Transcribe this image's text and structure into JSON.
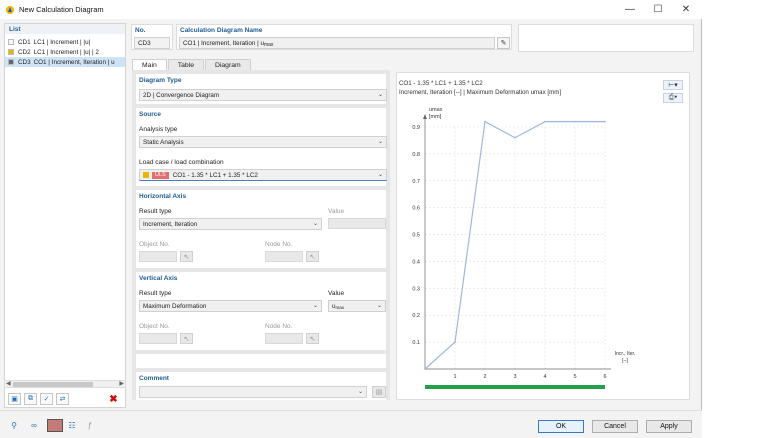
{
  "window": {
    "title": "New Calculation Diagram"
  },
  "list": {
    "header": "List",
    "items": [
      {
        "code": "CD1",
        "label": "LC1 | Increment | |u|",
        "color": "#f5f9fe",
        "selected": false
      },
      {
        "code": "CD2",
        "label": "LC1 | Increment | |u| | 2",
        "color": "#e6b800",
        "selected": false
      },
      {
        "code": "CD3",
        "label": "CO1 | Increment, Iteration | u",
        "color": "#666677",
        "selected": true
      }
    ]
  },
  "header": {
    "no_label": "No.",
    "no_value": "CD3",
    "name_label": "Calculation Diagram Name",
    "name_value": "CO1 | Increment, Iteration | u",
    "name_sub": "max"
  },
  "tabs": [
    {
      "label": "Main",
      "active": true
    },
    {
      "label": "Table",
      "active": false
    },
    {
      "label": "Diagram",
      "active": false
    }
  ],
  "form": {
    "diagram_type_label": "Diagram Type",
    "diagram_type_value": "2D | Convergence Diagram",
    "source_label": "Source",
    "analysis_type_label": "Analysis type",
    "analysis_type_value": "Static Analysis",
    "load_label": "Load case / load combination",
    "load_badge": "ULS",
    "load_value": "CO1 - 1.35 * LC1 + 1.35 * LC2",
    "h_axis_label": "Horizontal Axis",
    "h_result_label": "Result type",
    "h_result_value": "Increment, Iteration",
    "h_value_label": "Value",
    "h_object_label": "Object No.",
    "h_node_label": "Node No.",
    "v_axis_label": "Vertical Axis",
    "v_result_label": "Result type",
    "v_result_value": "Maximum Deformation",
    "v_value_label": "Value",
    "v_value_value": "u",
    "v_value_sub": "max",
    "v_object_label": "Object No.",
    "v_node_label": "Node No.",
    "comment_label": "Comment"
  },
  "chart_data": {
    "type": "line",
    "title_line1": "CO1 - 1.35 * LC1 + 1.35 * LC2",
    "title_line2": "Increment, Iteration [--] | Maximum Deformation umax [mm]",
    "ylabel_line1": "umax",
    "ylabel_line2": "[mm]",
    "xlabel_line1": "Incr., Iter.",
    "xlabel_line2": "[--]",
    "x": [
      0,
      1,
      2,
      3,
      4,
      5,
      6
    ],
    "y": [
      0,
      0.1,
      0.92,
      0.86,
      0.92,
      0.92,
      0.92
    ],
    "xlim": [
      0,
      6
    ],
    "ylim": [
      0,
      0.9
    ],
    "xticks": [
      "1",
      "2",
      "3",
      "4",
      "5",
      "6"
    ],
    "yticks": [
      "0.1",
      "0.2",
      "0.3",
      "0.4",
      "0.5",
      "0.6",
      "0.7",
      "0.8",
      "0.9"
    ],
    "grid": true,
    "line_color": "#9db8e0",
    "progress_color": "#22a04a",
    "progress": 1.0
  },
  "footer": {
    "ok": "OK",
    "cancel": "Cancel",
    "apply": "Apply"
  },
  "icons": [
    "search-icon",
    "units-icon",
    "color-icon",
    "info-icon",
    "function-icon"
  ]
}
